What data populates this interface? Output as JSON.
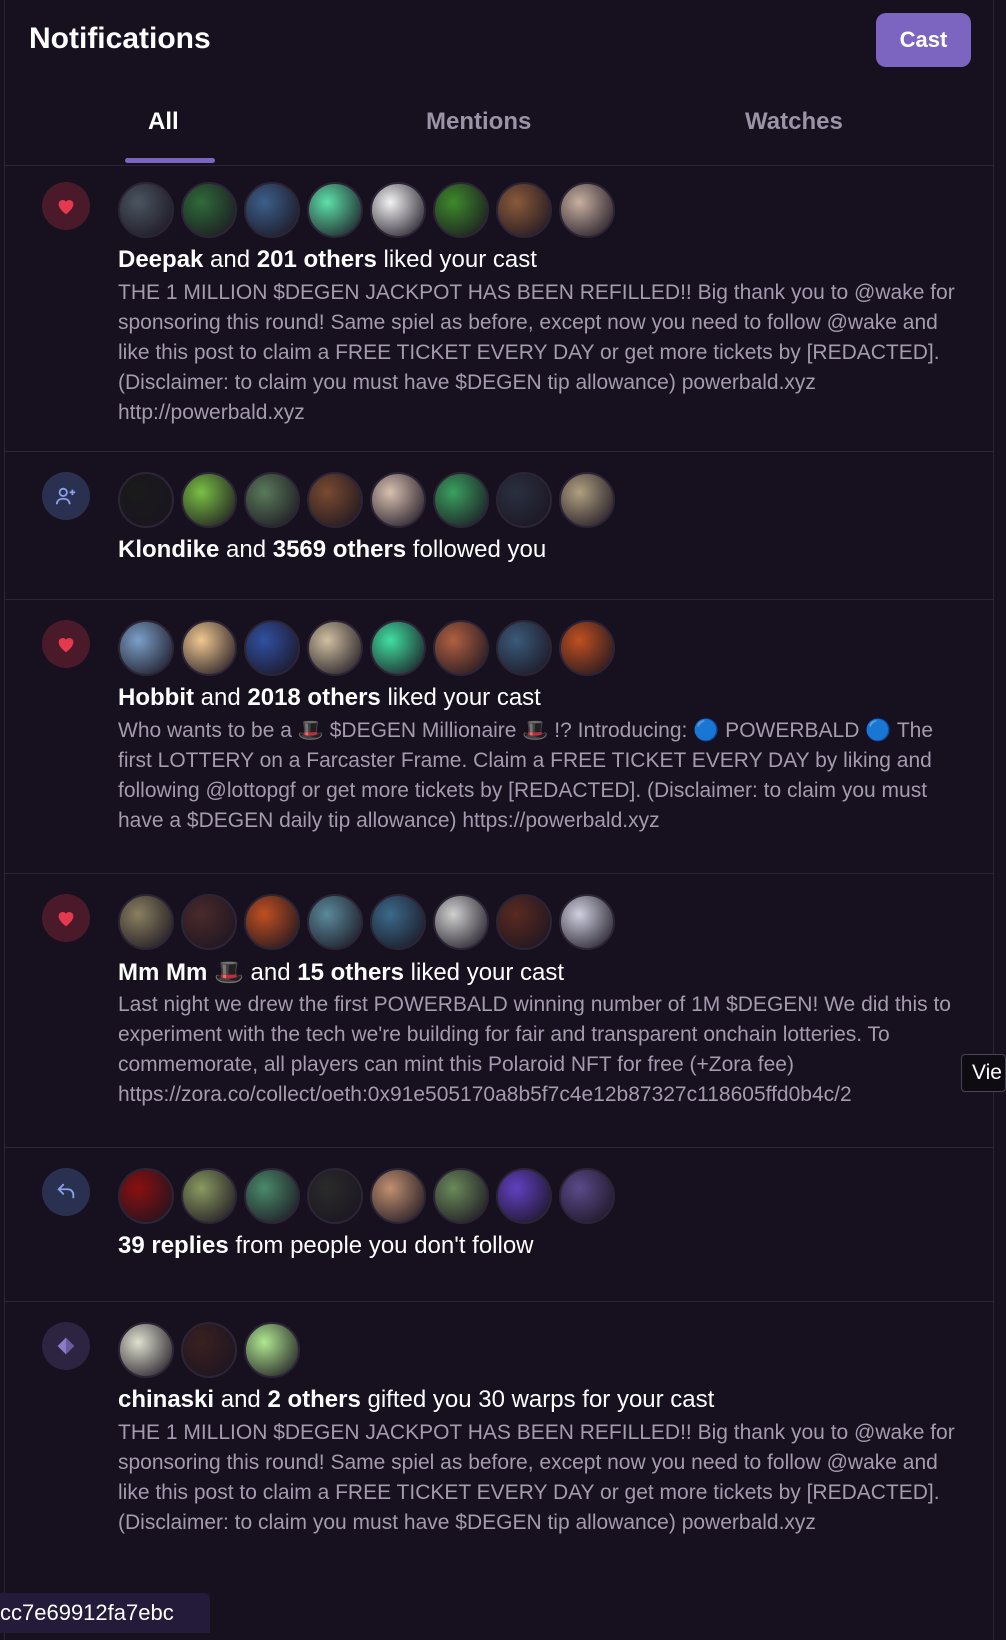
{
  "header": {
    "title": "Notifications",
    "cast_label": "Cast"
  },
  "tabs": [
    {
      "label": "All",
      "active": true
    },
    {
      "label": "Mentions",
      "active": false
    },
    {
      "label": "Watches",
      "active": false
    }
  ],
  "colors": {
    "accent": "#7c65c1",
    "background": "#17101f",
    "muted_text": "#a49cae",
    "like": "#e5394f",
    "action_blue": "#8aa0e8"
  },
  "notifications": [
    {
      "type_icon": "heart-icon",
      "actor": "Deepak",
      "mid": " and ",
      "others": "201 others",
      "action": " liked your cast",
      "body": "THE 1 MILLION $DEGEN JACKPOT HAS BEEN REFILLED!! Big thank you to @wake for sponsoring this round! Same spiel as before, except now you need to follow @wake and like this post to claim a FREE TICKET EVERY DAY or get more tickets by [REDACTED]. (Disclaimer: to claim you must have $DEGEN tip allowance) powerbald.xyz http://powerbald.xyz",
      "avatars": [
        "#4a5560",
        "#2f6b3a",
        "#3c5f8a",
        "#5ee0a8",
        "#f2f2f2",
        "#3d8a2a",
        "#8a5a3a",
        "#c8b0a0"
      ]
    },
    {
      "type_icon": "user-plus-icon",
      "actor": "Klondike",
      "mid": " and ",
      "others": "3569 others",
      "action": " followed you",
      "body": "",
      "avatars": [
        "#1a1a1a",
        "#7ac043",
        "#5a7a5a",
        "#7a4a30",
        "#d8c0b0",
        "#3aa060",
        "#2a3040",
        "#b0a080"
      ]
    },
    {
      "type_icon": "heart-icon",
      "actor": "Hobbit",
      "mid": " and ",
      "others": "2018 others",
      "action": " liked your cast",
      "body": "Who wants to be a 🎩 $DEGEN Millionaire 🎩 !? Introducing: 🔵 POWERBALD 🔵 The first LOTTERY on a Farcaster Frame. Claim a FREE TICKET EVERY DAY by liking and following @lottopgf or get more tickets by [REDACTED]. (Disclaimer: to claim you must have a $DEGEN daily tip allowance) https://powerbald.xyz",
      "avatars": [
        "#7aa0c8",
        "#f0c890",
        "#3050a0",
        "#d0c0a0",
        "#40e0a0",
        "#b06040",
        "#3a5a7a",
        "#c05020"
      ]
    },
    {
      "type_icon": "heart-icon",
      "actor": "Mm Mm 🎩",
      "mid": " and ",
      "others": "15 others",
      "action": " liked your cast",
      "body": "Last night we drew the first POWERBALD winning number of 1M $DEGEN! We did this to experiment with the tech we're building for fair and transparent onchain lotteries. To commemorate, all players can mint this Polaroid NFT for free (+Zora fee) https://zora.co/collect/oeth:0x91e505170a8b5f7c4e12b87327c118605ffd0b4c/2",
      "avatars": [
        "#8a8060",
        "#4a2a2a",
        "#c05020",
        "#5a8a9a",
        "#3a6a8a",
        "#d0d0d0",
        "#5a2a20",
        "#d0d0e0"
      ]
    },
    {
      "type_icon": "reply-icon",
      "actor": "",
      "mid": "",
      "others": "39 replies",
      "action": " from people you don't follow",
      "body": "",
      "avatars": [
        "#8a1010",
        "#8a9a60",
        "#4a8a6a",
        "#2a2a2a",
        "#c09070",
        "#6a8a5a",
        "#6040c0",
        "#5a4a8a"
      ]
    },
    {
      "type_icon": "gift-icon",
      "actor": "chinaski",
      "mid": " and ",
      "others": "2 others",
      "action": " gifted you 30 warps for your cast",
      "body": "THE 1 MILLION $DEGEN JACKPOT HAS BEEN REFILLED!! Big thank you to @wake for sponsoring this round! Same spiel as before, except now you need to follow @wake and like this post to claim a FREE TICKET EVERY DAY or get more tickets by [REDACTED]. (Disclaimer: to claim you must have $DEGEN tip allowance) powerbald.xyz",
      "avatars": [
        "#e0e0d0",
        "#3a2020",
        "#b0e890"
      ]
    }
  ],
  "tooltip": "Vie",
  "hash_label": "cc7e69912fa7ebc"
}
